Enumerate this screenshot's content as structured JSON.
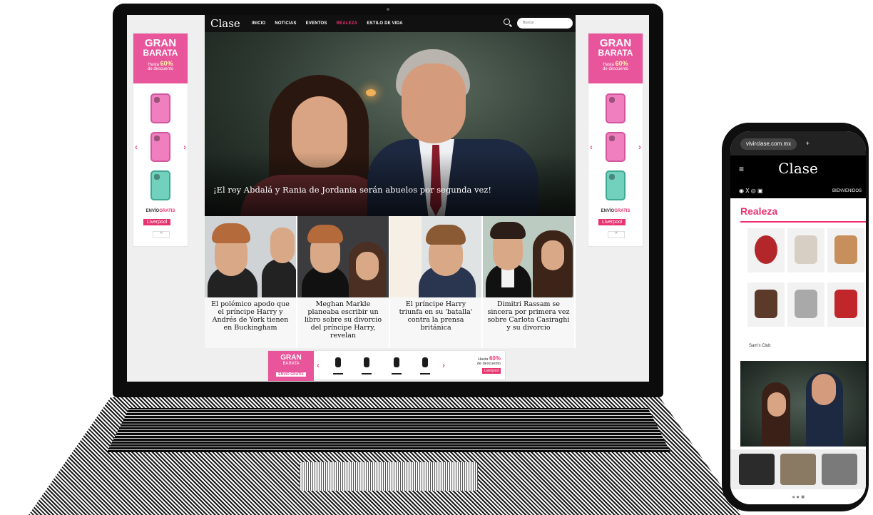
{
  "laptop": {
    "nav": {
      "logo": "Clase",
      "items": [
        "INICIO",
        "NOTICIAS",
        "EVENTOS",
        "REALEZA",
        "ESTILO DE VIDA"
      ],
      "active_index": 3,
      "search_placeholder": "Buscar"
    },
    "hero": {
      "caption": "¡El rey Abdalá y Rania de Jordania serán abuelos por segunda vez!"
    },
    "articles": [
      "El polémico apodo que el príncipe Harry y Andrés de York tienen en Buckingham",
      "Meghan Markle planeaba escribir un libro sobre su divorcio del príncipe Harry, revelan",
      "El príncipe Harry triunfa en su 'batalla' contra la prensa británica",
      "Dimitri Rassam se sincera por primera vez sobre Carlota Casiraghi y su divorcio"
    ],
    "side_ad": {
      "line1": "GRAN",
      "line2": "BARATA",
      "promo_prefix": "Hasta",
      "promo_value": "60%",
      "promo_suffix": "de descuento",
      "shipping_a": "ENVÍO",
      "shipping_b": "GRATIS",
      "brand": "Liverpool",
      "prev": "‹",
      "next": "›",
      "collapse": "^"
    },
    "bottom_ad": {
      "line1": "GRAN",
      "line2": "BARATA",
      "shipping": "ENVÍO GRATIS",
      "promo_prefix": "Hasta",
      "promo_value": "60%",
      "promo_suffix": "de descuento",
      "brand": "Liverpool",
      "prev": "‹",
      "next": "›"
    }
  },
  "phone": {
    "url": "vivirclase.com.mx",
    "plus": "+",
    "menu": "≡",
    "logo": "Clase",
    "social": "◉ X ◎ ▣",
    "right_label": "BIENVENIDOS",
    "section": "Realeza",
    "store": "Sam's Club",
    "nav": "◂   ●   ■"
  },
  "colors": {
    "brand_pink": "#e8336f",
    "ad_pink": "#e8559b",
    "nav_black": "#111111"
  }
}
